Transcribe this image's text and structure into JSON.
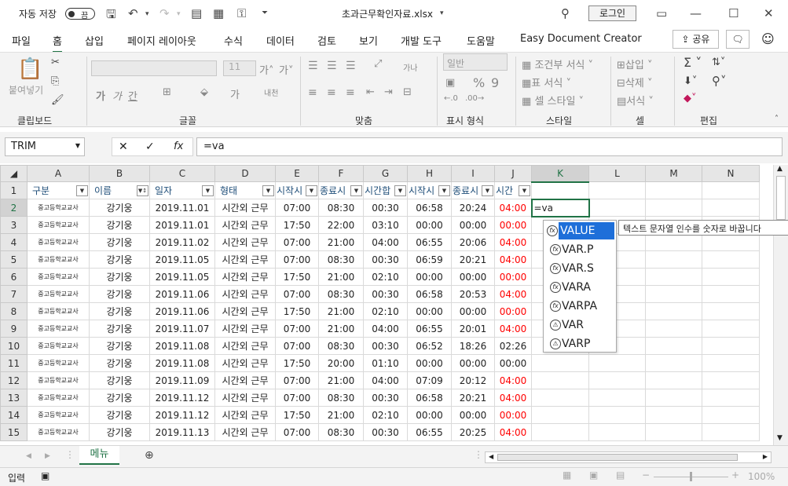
{
  "titlebar": {
    "autosave_label": "자동 저장",
    "toggle_state": "끔",
    "filename": "초과근무확인자료.xlsx",
    "login": "로그인"
  },
  "tabs": [
    "파일",
    "홈",
    "삽입",
    "페이지 레이아웃",
    "수식",
    "데이터",
    "검토",
    "보기",
    "개발 도구",
    "도움말",
    "Easy Document Creator"
  ],
  "share_label": "공유",
  "ribbon": {
    "groups": [
      "클립보드",
      "글꼴",
      "맞춤",
      "표시 형식",
      "스타일",
      "셀",
      "편집"
    ],
    "paste": "붙여넣기",
    "font_size": "11",
    "number_format": "일반",
    "cond_format": "조건부 서식",
    "table_format": "표 서식",
    "cell_style": "셀 스타일",
    "insert": "삽입",
    "delete": "삭제",
    "format": "서식"
  },
  "formula_bar": {
    "name_box": "TRIM",
    "formula": "=va"
  },
  "columns": [
    "A",
    "B",
    "C",
    "D",
    "E",
    "F",
    "G",
    "H",
    "I",
    "J",
    "K",
    "L",
    "M",
    "N"
  ],
  "headers": [
    "구분",
    "이름",
    "일자",
    "형태",
    "시작시",
    "종료시",
    "시간합",
    "시작시",
    "종료시",
    "시간"
  ],
  "rows": [
    {
      "n": "2",
      "a": "중고등학교교사",
      "b": "강기웅",
      "c": "2019.11.01",
      "d": "시간외 근무",
      "e": "07:00",
      "f": "08:30",
      "g": "00:30",
      "h": "06:58",
      "i": "20:24",
      "j": "04:00",
      "jred": true
    },
    {
      "n": "3",
      "a": "중고등학교교사",
      "b": "강기웅",
      "c": "2019.11.01",
      "d": "시간외 근무",
      "e": "17:50",
      "f": "22:00",
      "g": "03:10",
      "h": "00:00",
      "i": "00:00",
      "j": "00:00",
      "jred": true
    },
    {
      "n": "4",
      "a": "중고등학교교사",
      "b": "강기웅",
      "c": "2019.11.02",
      "d": "시간외 근무",
      "e": "07:00",
      "f": "21:00",
      "g": "04:00",
      "h": "06:55",
      "i": "20:06",
      "j": "04:00",
      "jred": true
    },
    {
      "n": "5",
      "a": "중고등학교교사",
      "b": "강기웅",
      "c": "2019.11.05",
      "d": "시간외 근무",
      "e": "07:00",
      "f": "08:30",
      "g": "00:30",
      "h": "06:59",
      "i": "20:21",
      "j": "04:00",
      "jred": true
    },
    {
      "n": "6",
      "a": "중고등학교교사",
      "b": "강기웅",
      "c": "2019.11.05",
      "d": "시간외 근무",
      "e": "17:50",
      "f": "21:00",
      "g": "02:10",
      "h": "00:00",
      "i": "00:00",
      "j": "00:00",
      "jred": true
    },
    {
      "n": "7",
      "a": "중고등학교교사",
      "b": "강기웅",
      "c": "2019.11.06",
      "d": "시간외 근무",
      "e": "07:00",
      "f": "08:30",
      "g": "00:30",
      "h": "06:58",
      "i": "20:53",
      "j": "04:00",
      "jred": true
    },
    {
      "n": "8",
      "a": "중고등학교교사",
      "b": "강기웅",
      "c": "2019.11.06",
      "d": "시간외 근무",
      "e": "17:50",
      "f": "21:00",
      "g": "02:10",
      "h": "00:00",
      "i": "00:00",
      "j": "00:00",
      "jred": true
    },
    {
      "n": "9",
      "a": "중고등학교교사",
      "b": "강기웅",
      "c": "2019.11.07",
      "d": "시간외 근무",
      "e": "07:00",
      "f": "21:00",
      "g": "04:00",
      "h": "06:55",
      "i": "20:01",
      "j": "04:00",
      "jred": true
    },
    {
      "n": "10",
      "a": "중고등학교교사",
      "b": "강기웅",
      "c": "2019.11.08",
      "d": "시간외 근무",
      "e": "07:00",
      "f": "08:30",
      "g": "00:30",
      "h": "06:52",
      "i": "18:26",
      "j": "02:26",
      "jred": false
    },
    {
      "n": "11",
      "a": "중고등학교교사",
      "b": "강기웅",
      "c": "2019.11.08",
      "d": "시간외 근무",
      "e": "17:50",
      "f": "20:00",
      "g": "01:10",
      "h": "00:00",
      "i": "00:00",
      "j": "00:00",
      "jred": false
    },
    {
      "n": "12",
      "a": "중고등학교교사",
      "b": "강기웅",
      "c": "2019.11.09",
      "d": "시간외 근무",
      "e": "07:00",
      "f": "21:00",
      "g": "04:00",
      "h": "07:09",
      "i": "20:12",
      "j": "04:00",
      "jred": true
    },
    {
      "n": "13",
      "a": "중고등학교교사",
      "b": "강기웅",
      "c": "2019.11.12",
      "d": "시간외 근무",
      "e": "07:00",
      "f": "08:30",
      "g": "00:30",
      "h": "06:58",
      "i": "20:21",
      "j": "04:00",
      "jred": true
    },
    {
      "n": "14",
      "a": "중고등학교교사",
      "b": "강기웅",
      "c": "2019.11.12",
      "d": "시간외 근무",
      "e": "17:50",
      "f": "21:00",
      "g": "02:10",
      "h": "00:00",
      "i": "00:00",
      "j": "00:00",
      "jred": true
    },
    {
      "n": "15",
      "a": "중고등학교교사",
      "b": "강기웅",
      "c": "2019.11.13",
      "d": "시간외 근무",
      "e": "07:00",
      "f": "08:30",
      "g": "00:30",
      "h": "06:55",
      "i": "20:25",
      "j": "04:00",
      "jred": true
    }
  ],
  "active_cell_value": "=va",
  "autocomplete": {
    "items": [
      "VALUE",
      "VAR.P",
      "VAR.S",
      "VARA",
      "VARPA",
      "VAR",
      "VARP"
    ],
    "tooltip": "텍스트 문자열 인수를 숫자로 바꿉니다"
  },
  "sheet_tab": "메뉴",
  "status": {
    "mode": "입력",
    "zoom": "100%"
  },
  "accent_color": "#217346"
}
